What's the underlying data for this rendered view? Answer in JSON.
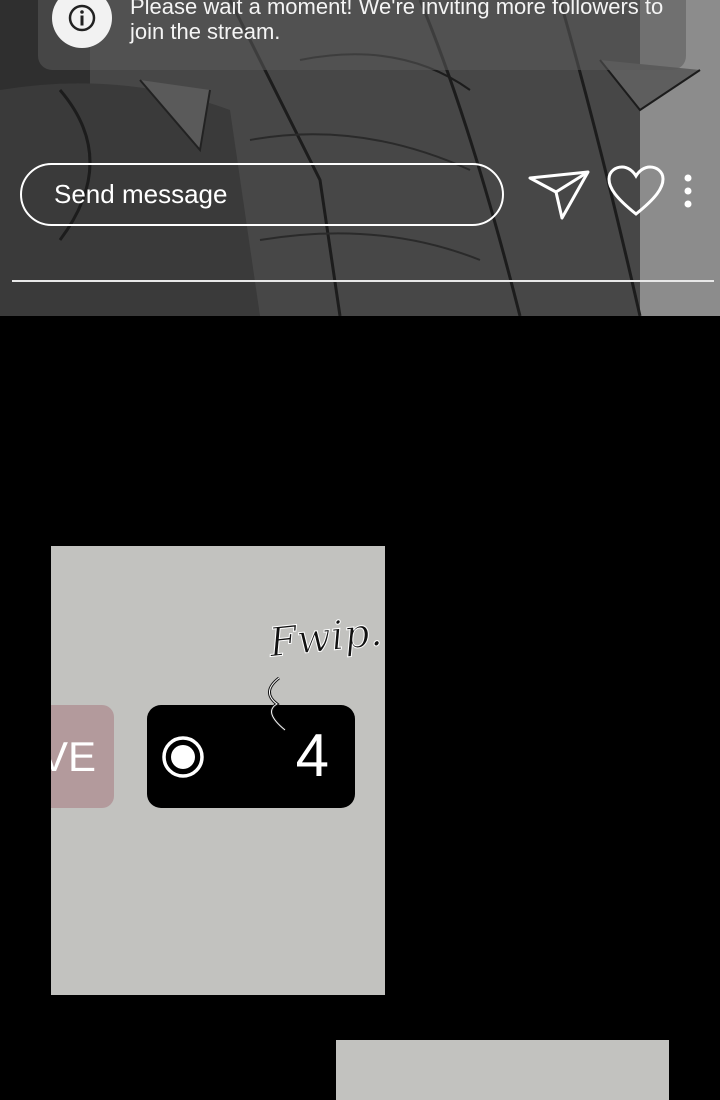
{
  "notification": {
    "icon": "info-icon",
    "text": "Please wait a moment! We're inviting more followers to join the stream."
  },
  "chat": {
    "placeholder": "Send message",
    "icons": [
      "send-icon",
      "heart-icon",
      "more-icon"
    ]
  },
  "live_badge": {
    "label": "VE"
  },
  "viewers": {
    "icon": "eye-icon",
    "count": "4"
  },
  "sound_effect": "Fwip..",
  "colors": {
    "panel_bg": "#c2c2bf",
    "live_tag": "#b39a9c",
    "badge_bg": "#000000"
  }
}
